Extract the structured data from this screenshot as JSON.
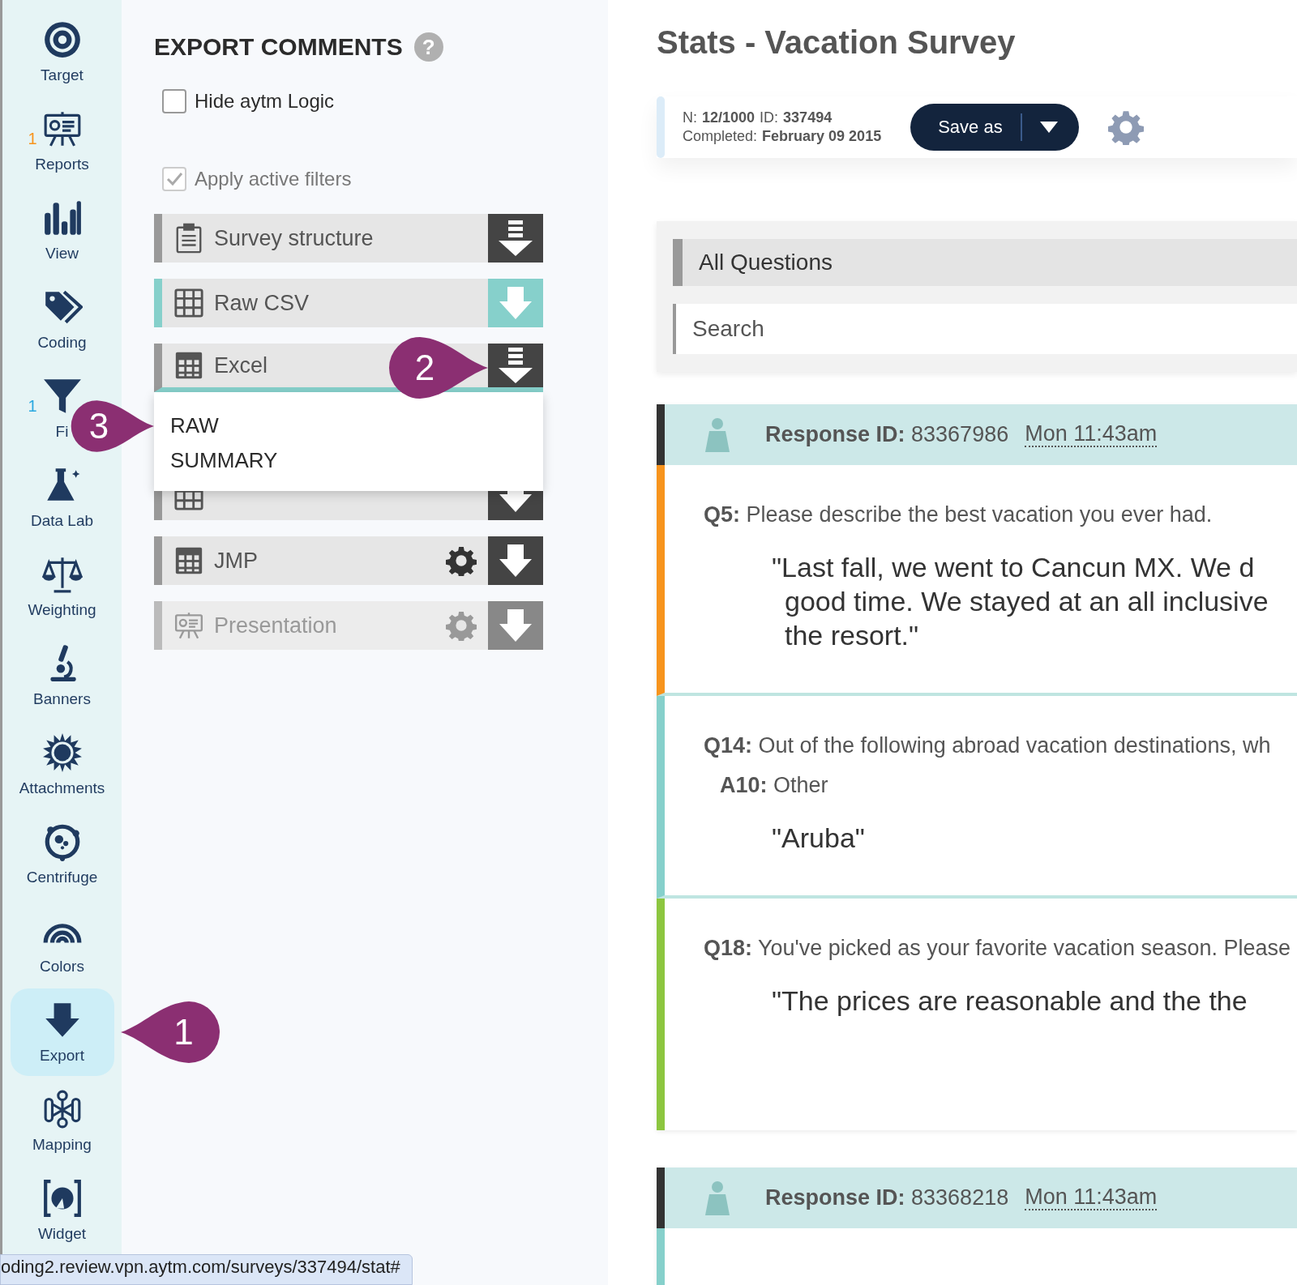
{
  "sidebar": {
    "items": [
      {
        "label": "Target",
        "selected": false
      },
      {
        "label": "Reports",
        "selected": false,
        "badge": {
          "text": "1",
          "color": "#f7941d"
        }
      },
      {
        "label": "View",
        "selected": false
      },
      {
        "label": "Coding",
        "selected": false
      },
      {
        "label": "Fi",
        "selected": false,
        "badge": {
          "text": "1",
          "color": "#29a8e0"
        }
      },
      {
        "label": "Data Lab",
        "selected": false
      },
      {
        "label": "Weighting",
        "selected": false
      },
      {
        "label": "Banners",
        "selected": false
      },
      {
        "label": "Attachments",
        "selected": false
      },
      {
        "label": "Centrifuge",
        "selected": false
      },
      {
        "label": "Colors",
        "selected": false
      },
      {
        "label": "Export",
        "selected": true
      },
      {
        "label": "Mapping",
        "selected": false
      },
      {
        "label": "Widget",
        "selected": false
      }
    ]
  },
  "export_panel": {
    "title": "EXPORT COMMENTS",
    "help": "?",
    "options": [
      {
        "label": "Hide aytm Logic",
        "checked": false,
        "disabled": false
      },
      {
        "label": "Apply active filters",
        "checked": true,
        "disabled": true
      }
    ],
    "formats": [
      {
        "label": "Survey structure",
        "highlighted": false,
        "expanded": false,
        "settings": false,
        "disabled": false
      },
      {
        "label": "Raw CSV",
        "highlighted": true,
        "expanded": false,
        "settings": false,
        "disabled": false
      },
      {
        "label": "Excel",
        "highlighted": false,
        "expanded": true,
        "settings": false,
        "disabled": false,
        "menu_items": [
          "RAW",
          "SUMMARY"
        ]
      },
      {
        "expanded": false
      },
      {
        "label": "JMP",
        "highlighted": false,
        "expanded": false,
        "settings": true,
        "disabled": false
      },
      {
        "label": "Presentation",
        "highlighted": false,
        "expanded": false,
        "settings": true,
        "disabled": true
      }
    ]
  },
  "main": {
    "title": "Stats - Vacation Survey",
    "info": {
      "n_label": "N:",
      "n_value": "12/1000",
      "id_label": "ID:",
      "id_value": "337494",
      "completed_label": "Completed:",
      "completed_value": "February 09 2015"
    },
    "save_button": "Save as",
    "question_filter": {
      "label": "All Questions",
      "search_placeholder": "Search"
    },
    "responses": [
      {
        "id_label": "Response ID:",
        "id": "83367986",
        "time": "Mon 11:43am",
        "answers": [
          {
            "color": "#f7941d",
            "question_label": "Q5:",
            "question": "Please describe the best vacation you ever had.",
            "quote_lines": [
              "\"Last fall, we went to Cancun MX. We d",
              "good time. We stayed at an all inclusive",
              "the resort.\""
            ]
          },
          {
            "color": "#86d0cb",
            "question_label": "Q14:",
            "question": "Out of the following abroad vacation destinations, wh",
            "option_label": "A10:",
            "option": "Other",
            "quote_lines": [
              "\"Aruba\""
            ]
          },
          {
            "color": "#8cc63f",
            "question_label": "Q18:",
            "question": "You've picked as your favorite vacation season. Please",
            "quote_lines": [
              "\"The prices are reasonable and the the"
            ]
          }
        ]
      },
      {
        "id_label": "Response ID:",
        "id": "83368218",
        "time": "Mon 11:43am",
        "answers": [
          {
            "color": "#86d0cb"
          }
        ]
      }
    ]
  },
  "annotations": [
    {
      "text": "1"
    },
    {
      "text": "2"
    },
    {
      "text": "3"
    }
  ],
  "status_url": "oding2.review.vpn.aytm.com/surveys/337494/stat#"
}
